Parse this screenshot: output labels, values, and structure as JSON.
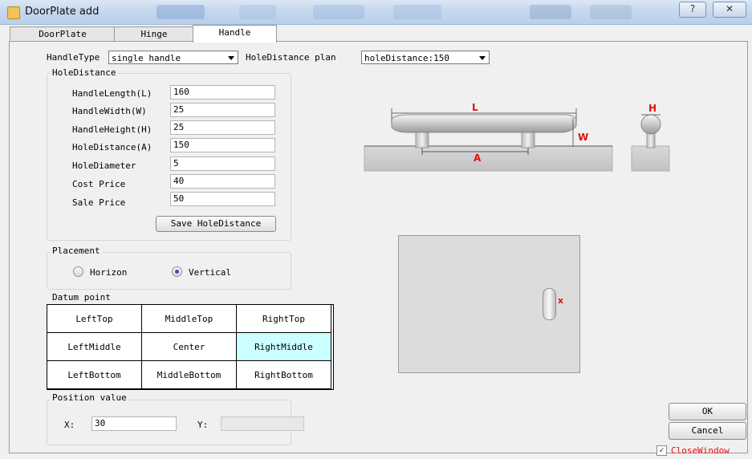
{
  "window": {
    "title": "DoorPlate add",
    "help_glyph": "?",
    "close_glyph": "✕"
  },
  "tabs": [
    {
      "label": "DoorPlate",
      "active": false
    },
    {
      "label": "Hinge",
      "active": false
    },
    {
      "label": "Handle",
      "active": true
    }
  ],
  "handle_type": {
    "label": "HandleType",
    "value": "single handle"
  },
  "hole_distance_plan": {
    "label": "HoleDistance plan",
    "value": "holeDistance:150"
  },
  "hole_distance_group": {
    "title": "HoleDistance",
    "fields": [
      {
        "label": "HandleLength(L)",
        "value": "160"
      },
      {
        "label": "HandleWidth(W)",
        "value": "25"
      },
      {
        "label": "HandleHeight(H)",
        "value": "25"
      },
      {
        "label": "HoleDistance(A)",
        "value": "150"
      },
      {
        "label": "HoleDiameter",
        "value": "5"
      },
      {
        "label": "Cost Price",
        "value": "40"
      },
      {
        "label": "Sale Price",
        "value": "50"
      }
    ],
    "save_label": "Save HoleDistance"
  },
  "placement": {
    "title": "Placement",
    "options": [
      "Horizon",
      "Vertical"
    ],
    "selected": "Vertical"
  },
  "datum_point": {
    "title": "Datum point",
    "cells": [
      "LeftTop",
      "MiddleTop",
      "RightTop",
      "LeftMiddle",
      "Center",
      "RightMiddle",
      "LeftBottom",
      "MiddleBottom",
      "RightBottom"
    ],
    "selected": "RightMiddle"
  },
  "position_value": {
    "title": "Position value",
    "x_label": "X:",
    "x_value": "30",
    "y_label": "Y:",
    "y_value": ""
  },
  "diagram": {
    "label_L": "L",
    "label_W": "W",
    "label_A": "A",
    "label_H": "H",
    "label_x": "x"
  },
  "buttons": {
    "ok": "OK",
    "cancel": "Cancel"
  },
  "close_window": {
    "label": "CloseWindow",
    "checked": true
  }
}
